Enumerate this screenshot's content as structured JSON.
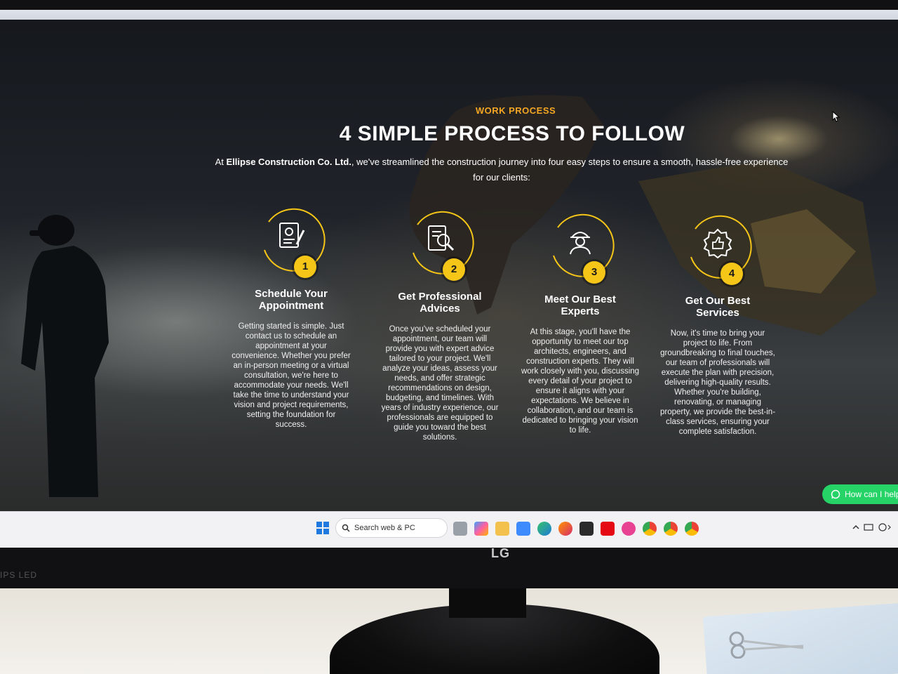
{
  "section": {
    "eyebrow": "WORK PROCESS",
    "title": "4 SIMPLE PROCESS TO FOLLOW",
    "intro_company": "Ellipse Construction Co. Ltd.",
    "intro_prefix": "At ",
    "intro_rest": ", we've streamlined the construction journey into four easy steps to ensure a smooth, hassle-free experience for our clients:"
  },
  "steps": [
    {
      "number": "1",
      "icon": "appointment-document-icon",
      "title_line1": "Schedule Your",
      "title_line2": "Appointment",
      "text": "Getting started is simple. Just contact us to schedule an appointment at your convenience. Whether you prefer an in-person meeting or a virtual consultation, we're here to accommodate your needs. We'll take the time to understand your vision and project requirements, setting the foundation for success."
    },
    {
      "number": "2",
      "icon": "document-search-icon",
      "title_line1": "Get Professional",
      "title_line2": "Advices",
      "text": "Once you've scheduled your appointment, our team will provide you with expert advice tailored to your project. We'll analyze your ideas, assess your needs, and offer strategic recommendations on design, budgeting, and timelines. With years of industry experience, our professionals are equipped to guide you toward the best solutions."
    },
    {
      "number": "3",
      "icon": "construction-worker-icon",
      "title_line1": "Meet Our Best",
      "title_line2": "Experts",
      "text": "At this stage, you'll have the opportunity to meet our top architects, engineers, and construction experts. They will work closely with you, discussing every detail of your project to ensure it aligns with your expectations. We believe in collaboration, and our team is dedicated to bringing your vision to life."
    },
    {
      "number": "4",
      "icon": "thumbs-up-badge-icon",
      "title_line1": "Get Our Best",
      "title_line2": "Services",
      "text": "Now, it's time to bring your project to life. From groundbreaking to final touches, our team of professionals will execute the plan with precision, delivering high-quality results. Whether you're building, renovating, or managing property, we provide the best-in-class services, ensuring your complete satisfaction."
    }
  ],
  "chat_widget": {
    "label": "How can I help"
  },
  "taskbar": {
    "search_label": "Search web & PC"
  },
  "monitor": {
    "brand": "LG",
    "badge": "IPS LED"
  },
  "colors": {
    "accent": "#f5a623",
    "number_badge": "#f5c518",
    "whatsapp": "#25d366"
  }
}
